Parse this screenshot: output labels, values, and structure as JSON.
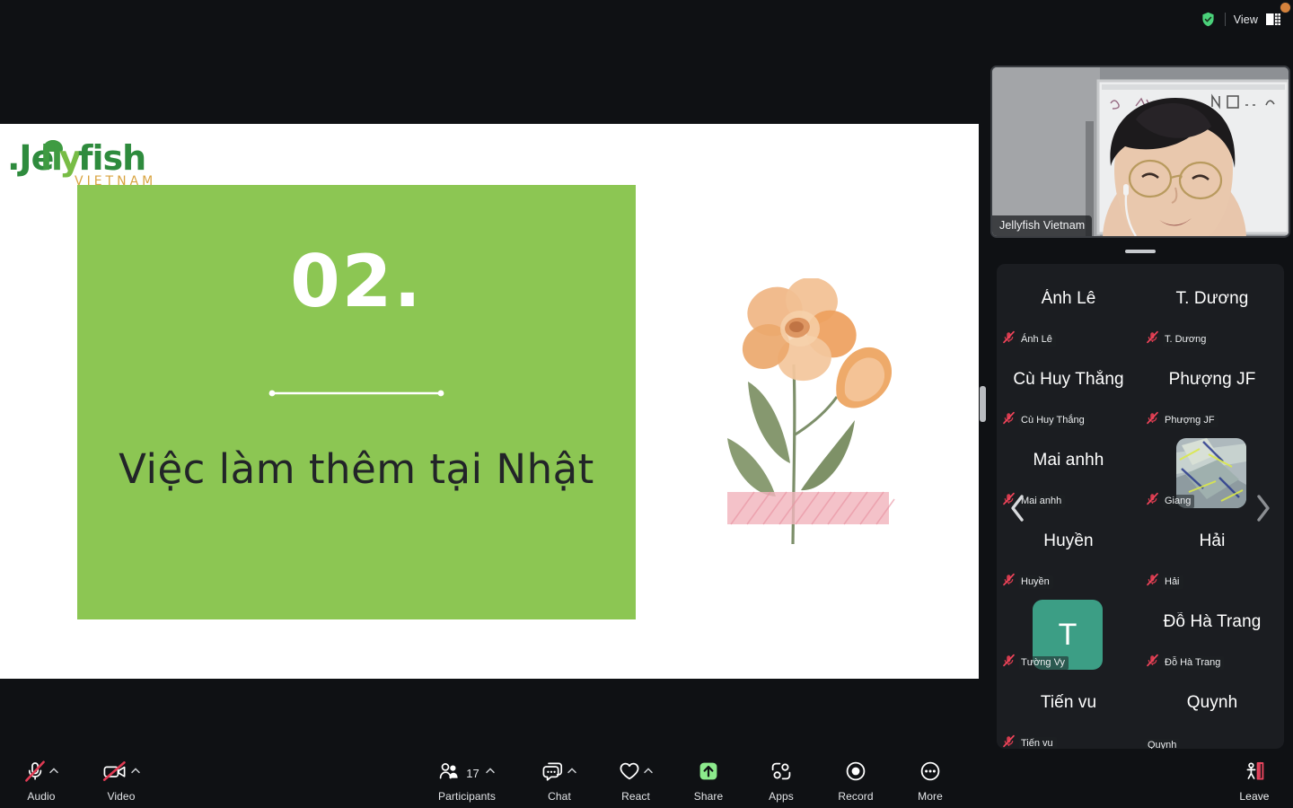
{
  "topbar": {
    "shield_icon": "shield-check-icon",
    "view_label": "View",
    "view_icon": "layout-grid-icon",
    "profile_dot": "avatar-dot"
  },
  "shared_screen": {
    "logo_main": "Jellyfish",
    "logo_sub": "VIETNAM",
    "logo_colors": {
      "main": "#2e8b3d",
      "accent": "#77bc45",
      "sub": "#d9a441"
    },
    "slide": {
      "background": "#8cc653",
      "number": "02.",
      "title": "Việc làm thêm tại Nhật",
      "divider": "dotted-end-line",
      "illustration": "watercolor-flower-with-washi-tape"
    }
  },
  "self_view": {
    "name": "Jellyfish Vietnam"
  },
  "participants_strip": {
    "prev_label": "‹",
    "next_label": "›",
    "tiles": [
      {
        "name": "Ánh Lê",
        "footer": "Ánh Lê",
        "muted": true,
        "kind": "name"
      },
      {
        "name": "T. Dương",
        "footer": "T. Dương",
        "muted": true,
        "kind": "name"
      },
      {
        "name": "Cù Huy Thắng",
        "footer": "Cù Huy Thắng",
        "muted": true,
        "kind": "name"
      },
      {
        "name": "Phượng JF",
        "footer": "Phượng JF",
        "muted": true,
        "kind": "name"
      },
      {
        "name": "Mai anhh",
        "footer": "Mai anhh",
        "muted": true,
        "kind": "name"
      },
      {
        "name": "Giang",
        "footer": "Giang",
        "muted": true,
        "kind": "video"
      },
      {
        "name": "Huyền",
        "footer": "Huyền",
        "muted": true,
        "kind": "name"
      },
      {
        "name": "Hải",
        "footer": "Hải",
        "muted": true,
        "kind": "name"
      },
      {
        "name": "Tường Vy",
        "footer": "Tường Vy",
        "muted": true,
        "kind": "avatar",
        "avatar_letter": "T",
        "avatar_color": "#3c9e85"
      },
      {
        "name": "Đỗ Hà Trang",
        "footer": "Đỗ Hà Trang",
        "muted": true,
        "kind": "name"
      },
      {
        "name": "Tiến vu",
        "footer": "Tiến vu",
        "muted": true,
        "kind": "name"
      },
      {
        "name": "Quynh",
        "footer": "Quynh",
        "muted": false,
        "kind": "name"
      }
    ]
  },
  "toolbar": {
    "audio": {
      "label": "Audio",
      "icon": "microphone-muted-icon",
      "has_caret": true
    },
    "video": {
      "label": "Video",
      "icon": "camera-muted-icon",
      "has_caret": true
    },
    "participants": {
      "label": "Participants",
      "icon": "participants-icon",
      "count": "17",
      "has_caret": true
    },
    "chat": {
      "label": "Chat",
      "icon": "chat-bubble-icon",
      "has_caret": true
    },
    "react": {
      "label": "React",
      "icon": "heart-icon",
      "has_caret": true
    },
    "share": {
      "label": "Share",
      "icon": "share-screen-icon",
      "has_caret": false,
      "accent": "#8cea8c"
    },
    "apps": {
      "label": "Apps",
      "icon": "apps-icon",
      "has_caret": false
    },
    "record": {
      "label": "Record",
      "icon": "record-icon",
      "has_caret": false
    },
    "more": {
      "label": "More",
      "icon": "ellipsis-icon",
      "has_caret": false
    },
    "leave": {
      "label": "Leave",
      "icon": "leave-door-icon",
      "accent": "#e8455e"
    }
  }
}
